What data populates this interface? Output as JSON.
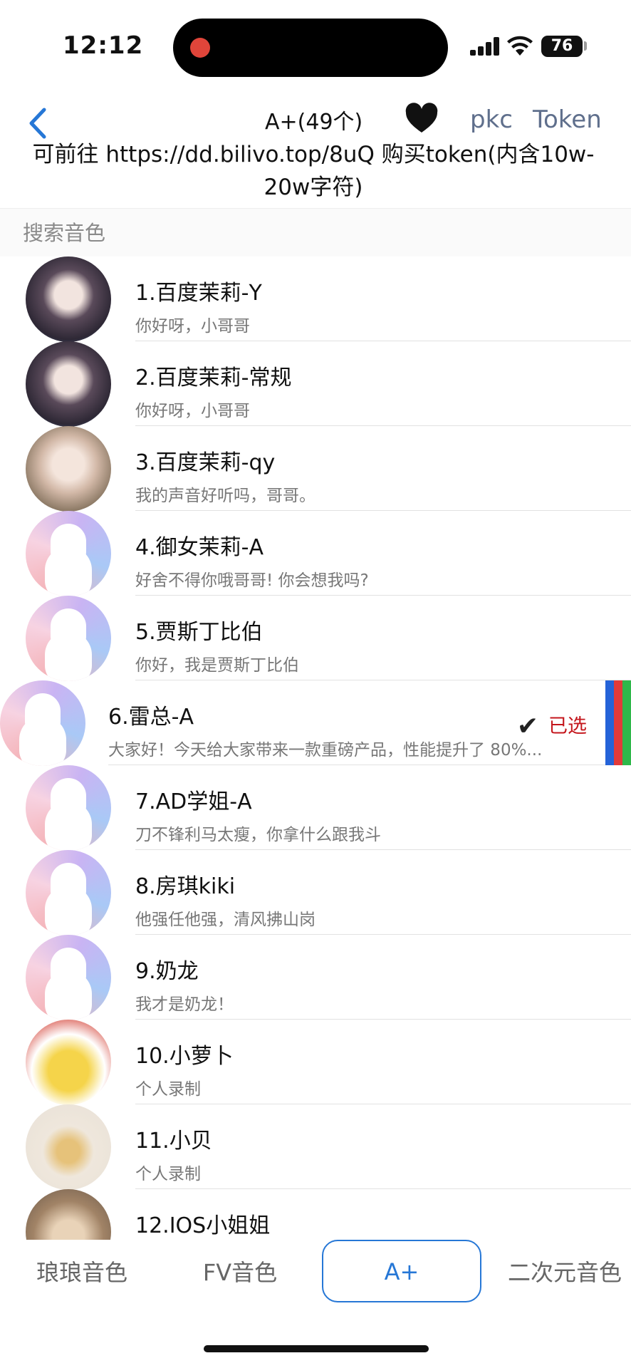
{
  "status_bar": {
    "time": "12:12",
    "battery": "76",
    "icons": [
      "signal-icon",
      "wifi-icon",
      "battery-icon"
    ]
  },
  "nav": {
    "title": "A+(49个)",
    "heart_icon": "heart-icon",
    "pkc": "pkc",
    "token": "Token",
    "notice": "可前往 https://dd.bilivo.top/8uQ 购买token(内含10w-20w字符)"
  },
  "search": {
    "placeholder": "搜索音色"
  },
  "voices": [
    {
      "title": "1.百度茉莉-Y",
      "subtitle": "你好呀，小哥哥",
      "avatar": "av-dark"
    },
    {
      "title": "2.百度茉莉-常规",
      "subtitle": "你好呀，小哥哥",
      "avatar": "av-dark"
    },
    {
      "title": "3.百度茉莉-qy",
      "subtitle": "我的声音好听吗，哥哥。",
      "avatar": "av-girl"
    },
    {
      "title": "4.御女茉莉-A",
      "subtitle": "好舍不得你哦哥哥! 你会想我吗?",
      "avatar": "av-default"
    },
    {
      "title": "5.贾斯丁比伯",
      "subtitle": "你好，我是贾斯丁比伯",
      "avatar": "av-default"
    },
    {
      "title": "6.雷总-A",
      "subtitle": "大家好！今天给大家带来一款重磅产品，性能提升了 80%...",
      "avatar": "av-default",
      "selected": true,
      "selected_label": "已选"
    },
    {
      "title": "7.AD学姐-A",
      "subtitle": "刀不锋利马太瘦，你拿什么跟我斗",
      "avatar": "av-default"
    },
    {
      "title": "8.房琪kiki",
      "subtitle": "他强任他强，清风拂山岗",
      "avatar": "av-default"
    },
    {
      "title": "9.奶龙",
      "subtitle": "我才是奶龙！",
      "avatar": "av-default"
    },
    {
      "title": "10.小萝卜",
      "subtitle": "个人录制",
      "avatar": "av-duck"
    },
    {
      "title": "11.小贝",
      "subtitle": "个人录制",
      "avatar": "av-beige"
    },
    {
      "title": "12.IOS小姐姐",
      "subtitle": "",
      "avatar": "av-brown"
    }
  ],
  "tabs": [
    {
      "label": "琅琅音色"
    },
    {
      "label": "FV音色"
    },
    {
      "label": "A+",
      "active": true
    },
    {
      "label": "二次元音色"
    }
  ],
  "colors": {
    "accent": "#2677d6",
    "selected_text": "#c4161c",
    "nav_link": "#5f6f8c",
    "stripes": [
      "#2563d8",
      "#e23a3a",
      "#2fb84a"
    ]
  }
}
